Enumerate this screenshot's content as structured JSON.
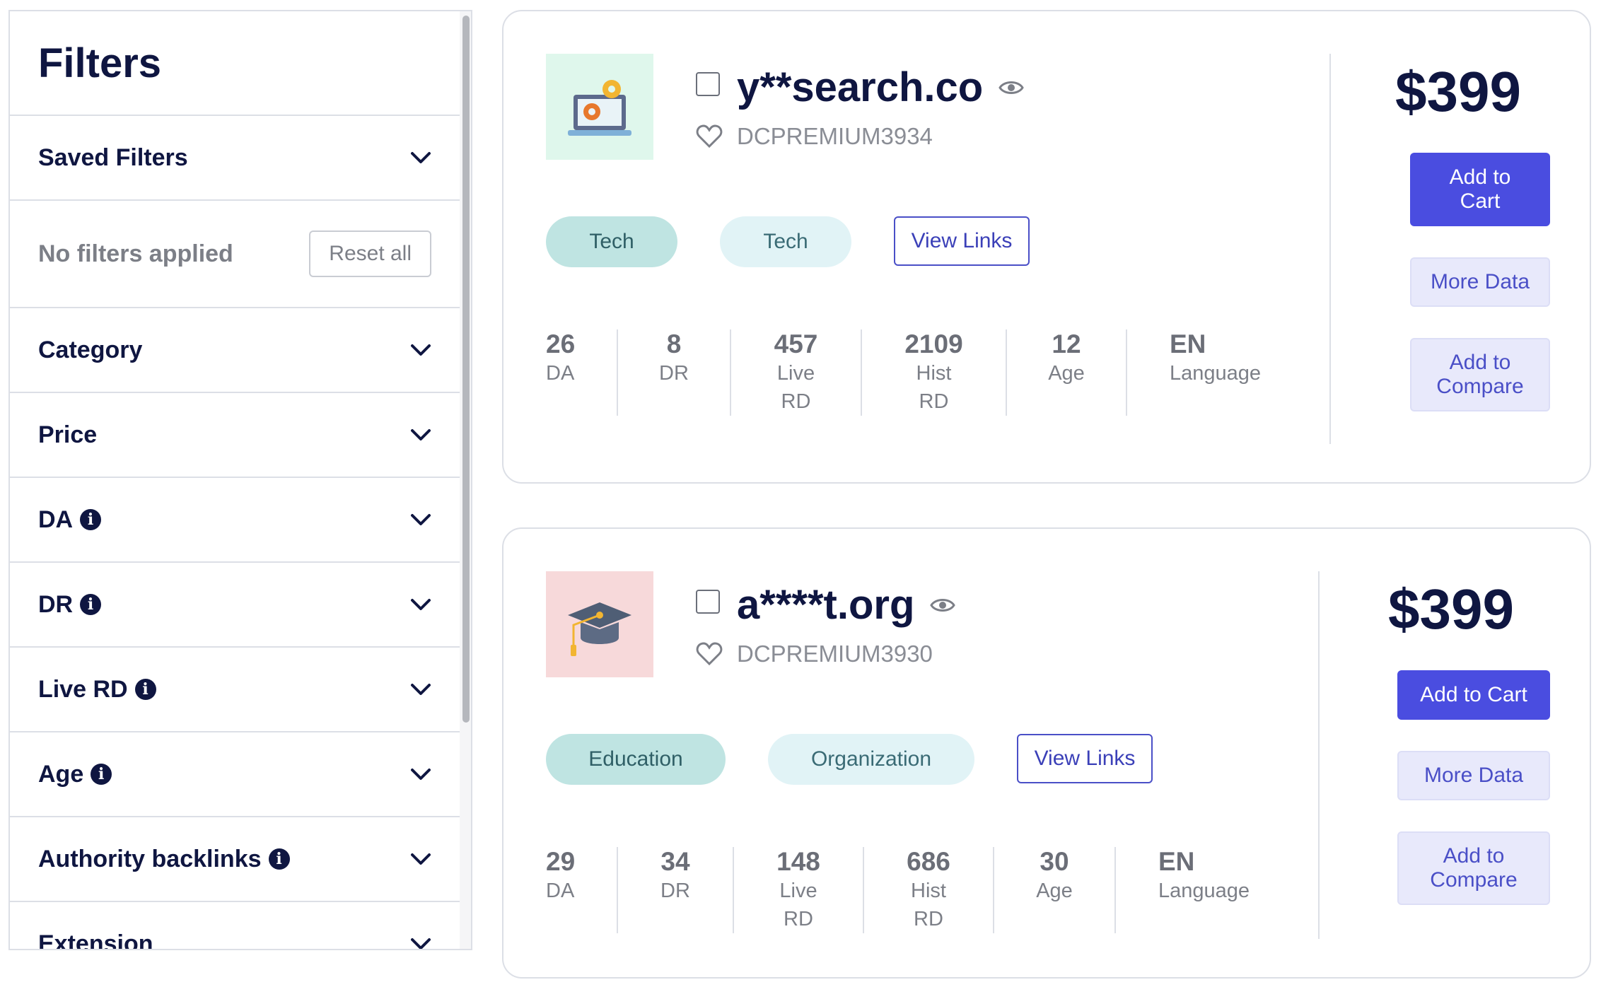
{
  "sidebar": {
    "title": "Filters",
    "saved_filters": "Saved Filters",
    "no_filters": "No filters applied",
    "reset_all": "Reset all",
    "sections": [
      {
        "label": "Category",
        "info": false
      },
      {
        "label": "Price",
        "info": false
      },
      {
        "label": "DA",
        "info": true
      },
      {
        "label": "DR",
        "info": true
      },
      {
        "label": "Live RD",
        "info": true
      },
      {
        "label": "Age",
        "info": true
      },
      {
        "label": "Authority backlinks",
        "info": true
      },
      {
        "label": "Extension",
        "info": false
      }
    ]
  },
  "listings": [
    {
      "domain": "y**search.co",
      "code": "DCPREMIUM3934",
      "thumb_icon": "laptop-gears-icon",
      "thumb_bg": "#dff7ec",
      "tags": [
        "Tech",
        "Tech"
      ],
      "view_links": "View Links",
      "price": "$399",
      "add_to_cart": "Add to Cart",
      "more_data": "More Data",
      "add_to_compare": "Add to Compare",
      "stats": [
        {
          "value": "26",
          "label": "DA"
        },
        {
          "value": "8",
          "label": "DR"
        },
        {
          "value": "457",
          "label": "Live RD"
        },
        {
          "value": "2109",
          "label": "Hist RD"
        },
        {
          "value": "12",
          "label": "Age"
        },
        {
          "value": "EN",
          "label": "Language"
        }
      ]
    },
    {
      "domain": "a****t.org",
      "code": "DCPREMIUM3930",
      "thumb_icon": "graduation-cap-icon",
      "thumb_bg": "#f7d9da",
      "tags": [
        "Education",
        "Organization"
      ],
      "view_links": "View Links",
      "price": "$399",
      "add_to_cart": "Add to Cart",
      "more_data": "More Data",
      "add_to_compare": "Add to Compare",
      "stats": [
        {
          "value": "29",
          "label": "DA"
        },
        {
          "value": "34",
          "label": "DR"
        },
        {
          "value": "148",
          "label": "Live RD"
        },
        {
          "value": "686",
          "label": "Hist RD"
        },
        {
          "value": "30",
          "label": "Age"
        },
        {
          "value": "EN",
          "label": "Language"
        }
      ]
    }
  ],
  "colors": {
    "primary": "#4a4de0",
    "navy": "#0f1641",
    "tag_primary": "#bfe4e2",
    "tag_secondary": "#e1f3f6"
  }
}
